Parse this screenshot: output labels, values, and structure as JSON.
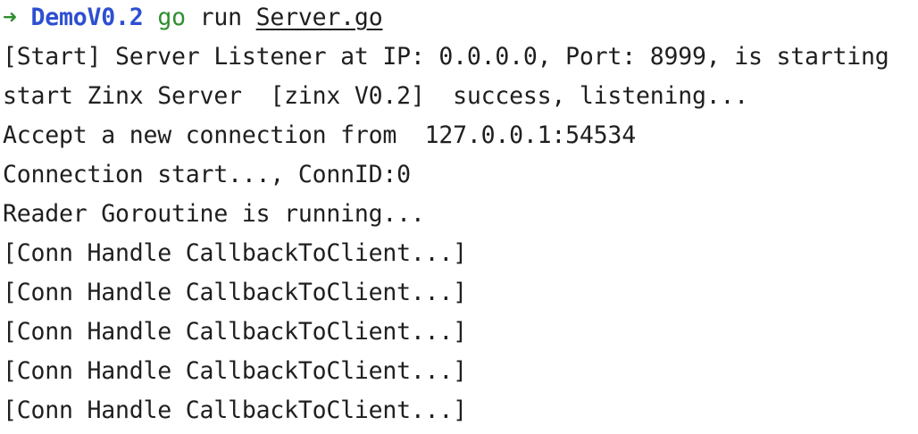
{
  "prompt": {
    "arrow": "➜",
    "dir": "DemoV0.2",
    "command": "go",
    "subcommand": "run",
    "arg": "Server.go"
  },
  "output": [
    "[Start] Server Listener at IP: 0.0.0.0, Port: 8999, is starting",
    "start Zinx Server  [zinx V0.2]  success, listening...",
    "Accept a new connection from  127.0.0.1:54534",
    "Connection start..., ConnID:0",
    "Reader Goroutine is running...",
    "[Conn Handle CallbackToClient...]",
    "[Conn Handle CallbackToClient...]",
    "[Conn Handle CallbackToClient...]",
    "[Conn Handle CallbackToClient...]",
    "[Conn Handle CallbackToClient...]"
  ],
  "colors": {
    "background": "#ffffff",
    "text": "#1f1f1f",
    "prompt_arrow": "#2f8f2f",
    "prompt_dir": "#2d4fd1",
    "command": "#2f8f2f"
  },
  "icons": {
    "prompt_arrow": "arrow-right-icon"
  }
}
